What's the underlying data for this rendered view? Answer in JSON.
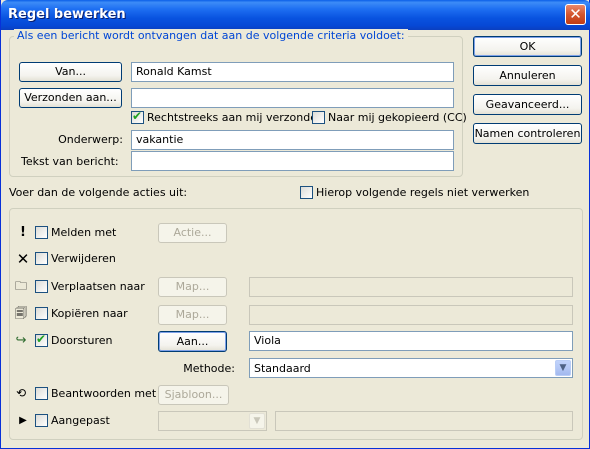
{
  "window": {
    "title": "Regel bewerken",
    "close_glyph": "✕"
  },
  "criteria": {
    "legend": "Als een bericht wordt ontvangen dat aan de volgende criteria voldoet:",
    "van_button": "Van...",
    "van_value": "Ronald Kamst",
    "verzonden_button": "Verzonden aan...",
    "verzonden_value": "",
    "rechtstreeks_label": "Rechtstreeks aan mij verzonden",
    "rechtstreeks_checked": true,
    "gekopieerd_label": "Naar mij gekopieerd (CC)",
    "gekopieerd_checked": false,
    "onderwerp_label": "Onderwerp:",
    "onderwerp_value": "vakantie",
    "tekst_label": "Tekst van bericht:",
    "tekst_value": ""
  },
  "side_buttons": {
    "ok": "OK",
    "annuleren": "Annuleren",
    "geavanceerd": "Geavanceerd...",
    "namen": "Namen controleren"
  },
  "actions_heading": "Voer dan de volgende acties uit:",
  "stop_rules": {
    "label": "Hierop volgende regels niet verwerken",
    "checked": false
  },
  "actions": {
    "melden": {
      "icon": "exclamation-icon",
      "label": "Melden met",
      "button": "Actie...",
      "checked": false
    },
    "verwijderen": {
      "icon": "delete-x-icon",
      "label": "Verwijderen",
      "checked": false
    },
    "verplaatsen": {
      "icon": "move-to-folder-icon",
      "label": "Verplaatsen naar",
      "button": "Map...",
      "value": "",
      "checked": false
    },
    "kopieren": {
      "icon": "copy-to-folder-icon",
      "label": "Kopiëren naar",
      "button": "Map...",
      "value": "",
      "checked": false
    },
    "doorsturen": {
      "icon": "forward-icon",
      "label": "Doorsturen",
      "button": "Aan...",
      "value": "Viola",
      "checked": true
    },
    "methode": {
      "label": "Methode:",
      "value": "Standaard"
    },
    "beantwoorden": {
      "icon": "reply-template-icon",
      "label": "Beantwoorden met",
      "button": "Sjabloon...",
      "checked": false
    },
    "aangepast": {
      "icon": "triangle-right-icon",
      "label": "Aangepast",
      "value": "",
      "checked": false
    }
  }
}
